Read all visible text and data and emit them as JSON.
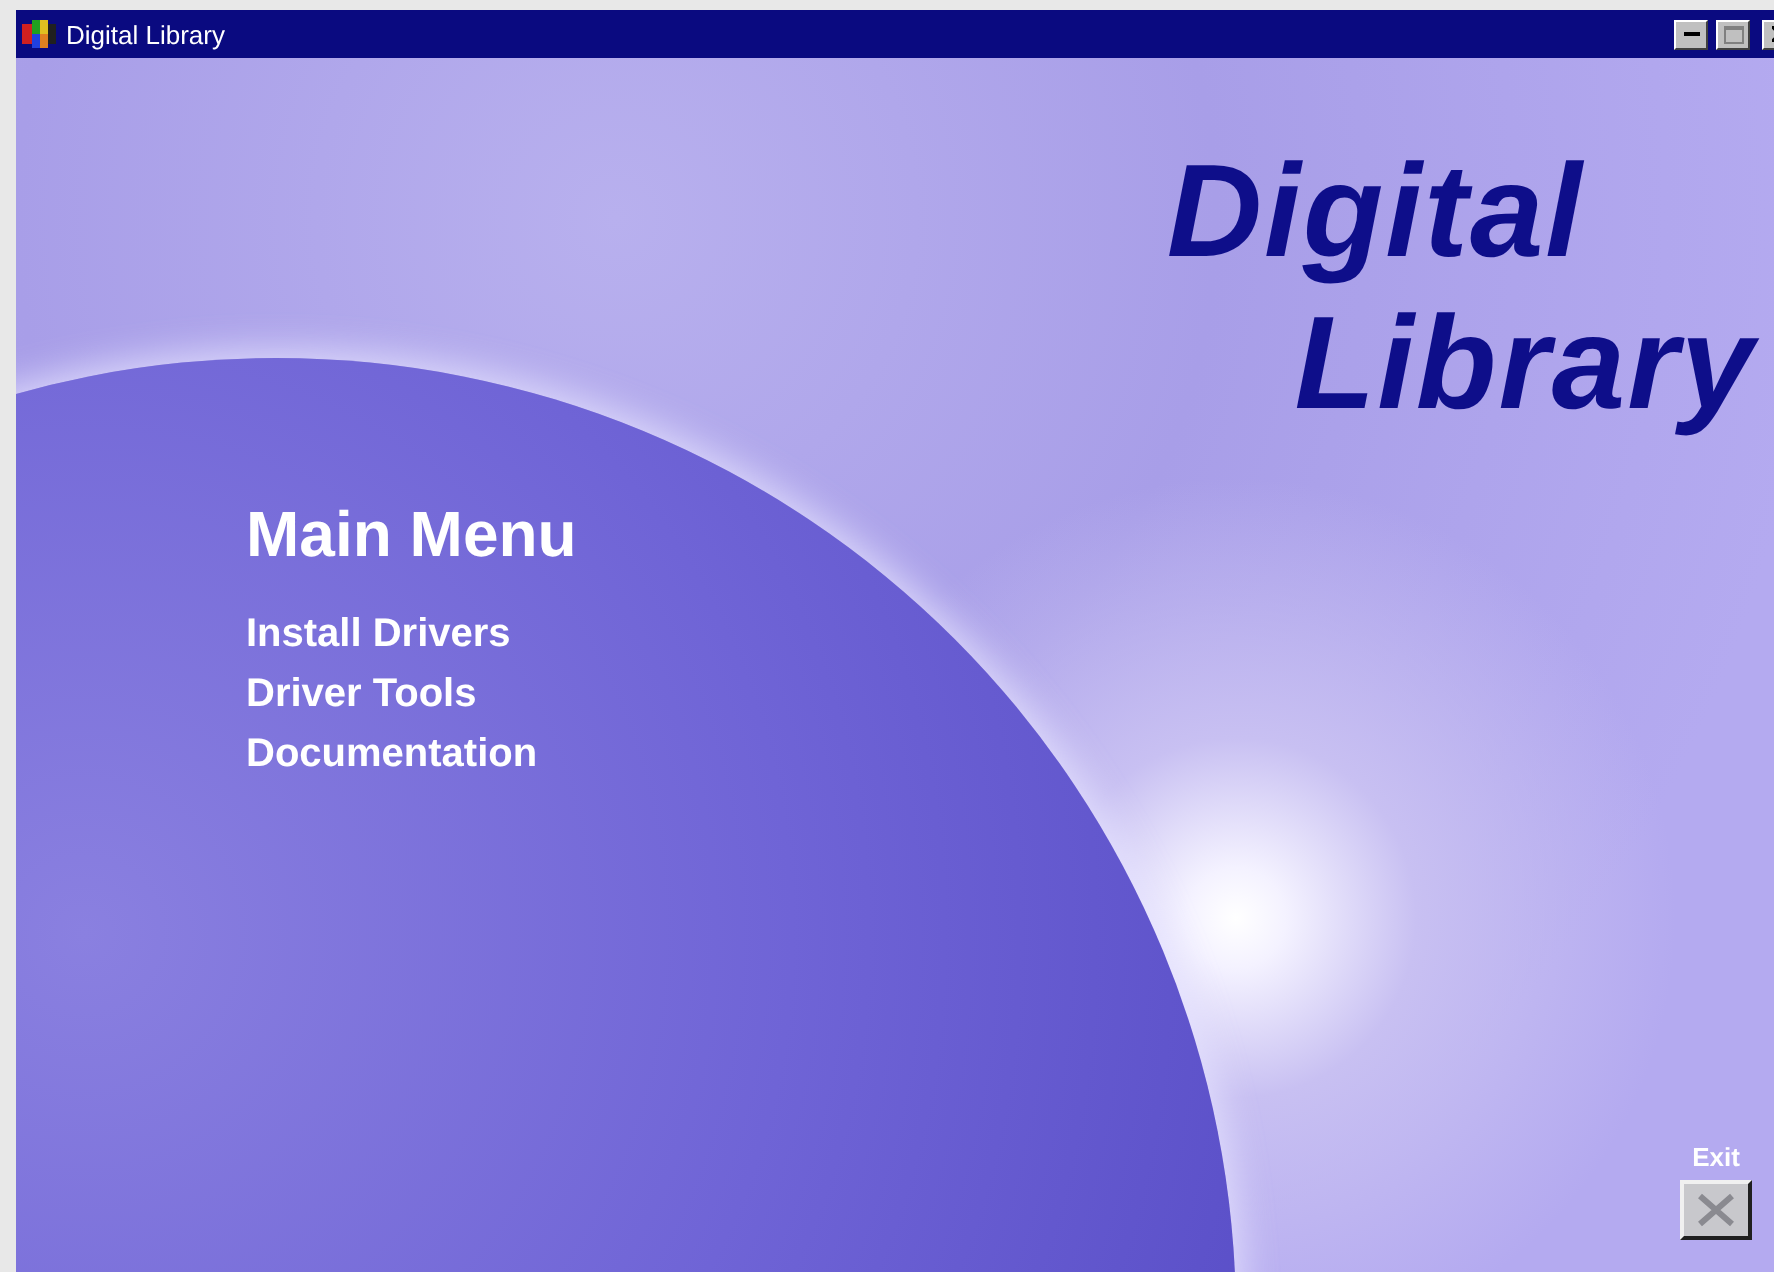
{
  "window": {
    "title": "Digital Library",
    "controls": [
      {
        "kind": "minimize",
        "disabled": false
      },
      {
        "kind": "maximize",
        "disabled": true
      },
      {
        "kind": "close",
        "disabled": false
      }
    ]
  },
  "logo": {
    "lines": [
      "Digital",
      "Library"
    ]
  },
  "menu": {
    "title": "Main Menu",
    "items": [
      "Install Drivers",
      "Driver Tools",
      "Documentation"
    ]
  },
  "exit": {
    "label": "Exit"
  }
}
